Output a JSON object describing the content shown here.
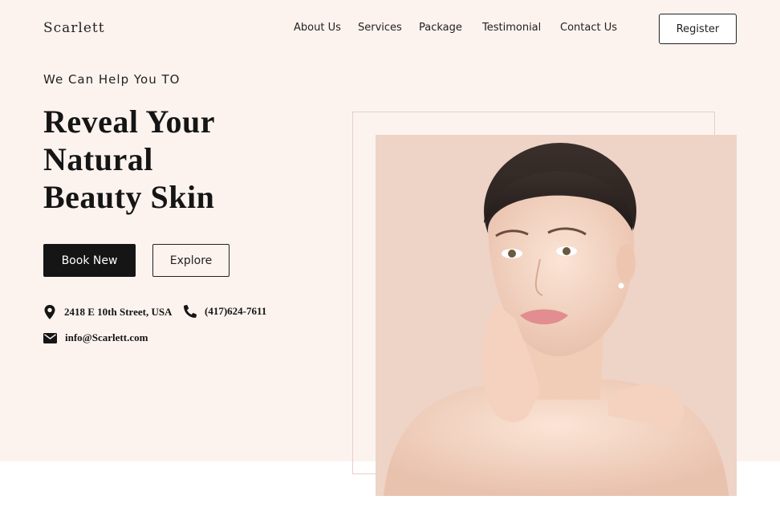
{
  "brand": {
    "logo": "Scarlett"
  },
  "nav": {
    "items": [
      "About Us",
      "Services",
      "Package",
      "Testimonial",
      "Contact Us"
    ],
    "register_label": "Register"
  },
  "hero": {
    "kicker": "We Can Help You TO",
    "headline_lines": [
      "Reveal Your",
      "Natural",
      "Beauty Skin"
    ],
    "primary_button": "Book New",
    "secondary_button": "Explore",
    "contact": {
      "address": "2418 E 10th Street, USA",
      "phone": "(417)624-7611",
      "email": "info@Scarlett.com"
    },
    "image_icon": "woman-portrait-image"
  },
  "colors": {
    "hero_background": "#fcf3ef",
    "photo_background": "#eed3c7",
    "primary_button": "#151515",
    "frame_border": "#e8cfc6"
  }
}
